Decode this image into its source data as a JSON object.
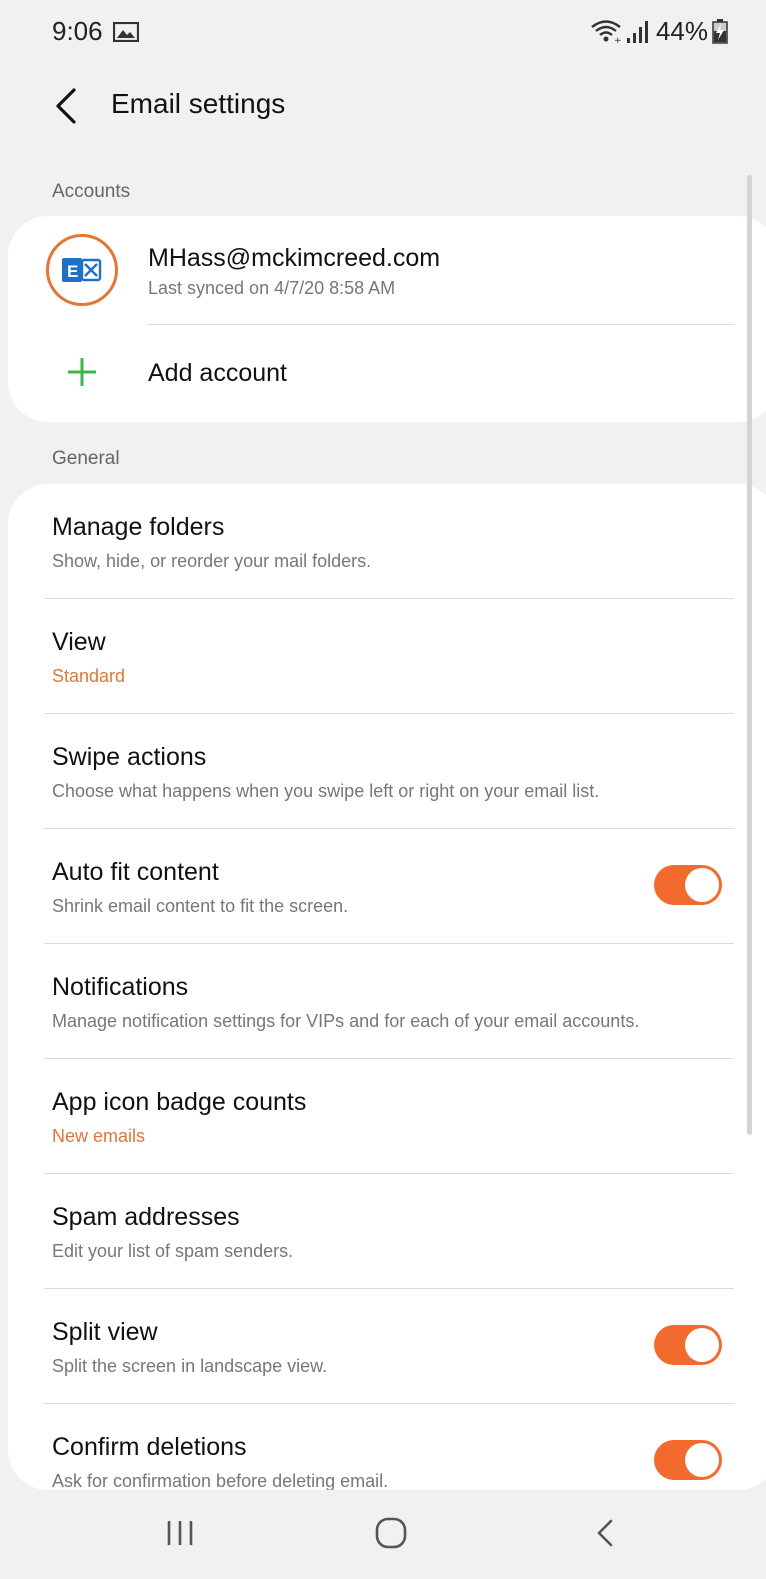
{
  "status_bar": {
    "time": "9:06",
    "battery": "44%"
  },
  "header": {
    "title": "Email settings"
  },
  "sections": {
    "accounts_label": "Accounts",
    "general_label": "General"
  },
  "account": {
    "email": "MHass@mckimcreed.com",
    "last_synced": "Last synced on 4/7/20  8:58 AM",
    "icon": "exchange-icon"
  },
  "add_account": {
    "label": "Add account"
  },
  "settings": [
    {
      "title": "Manage folders",
      "subtitle": "Show, hide, or reorder your mail folders."
    },
    {
      "title": "View",
      "subtitle": "Standard"
    },
    {
      "title": "Swipe actions",
      "subtitle": "Choose what happens when you swipe left or right on your email list."
    },
    {
      "title": "Auto fit content",
      "subtitle": "Shrink email content to fit the screen.",
      "toggle": true
    },
    {
      "title": "Notifications",
      "subtitle": "Manage notification settings for VIPs and for each of your email accounts."
    },
    {
      "title": "App icon badge counts",
      "subtitle": "New emails"
    },
    {
      "title": "Spam addresses",
      "subtitle": "Edit your list of spam senders."
    },
    {
      "title": "Split view",
      "subtitle": "Split the screen in landscape view.",
      "toggle": true
    },
    {
      "title": "Confirm deletions",
      "subtitle": "Ask for confirmation before deleting email.",
      "toggle": true
    }
  ],
  "colors": {
    "accent": "#e0763a",
    "toggle_on": "#f26a2e",
    "add_icon": "#3bb54a"
  }
}
